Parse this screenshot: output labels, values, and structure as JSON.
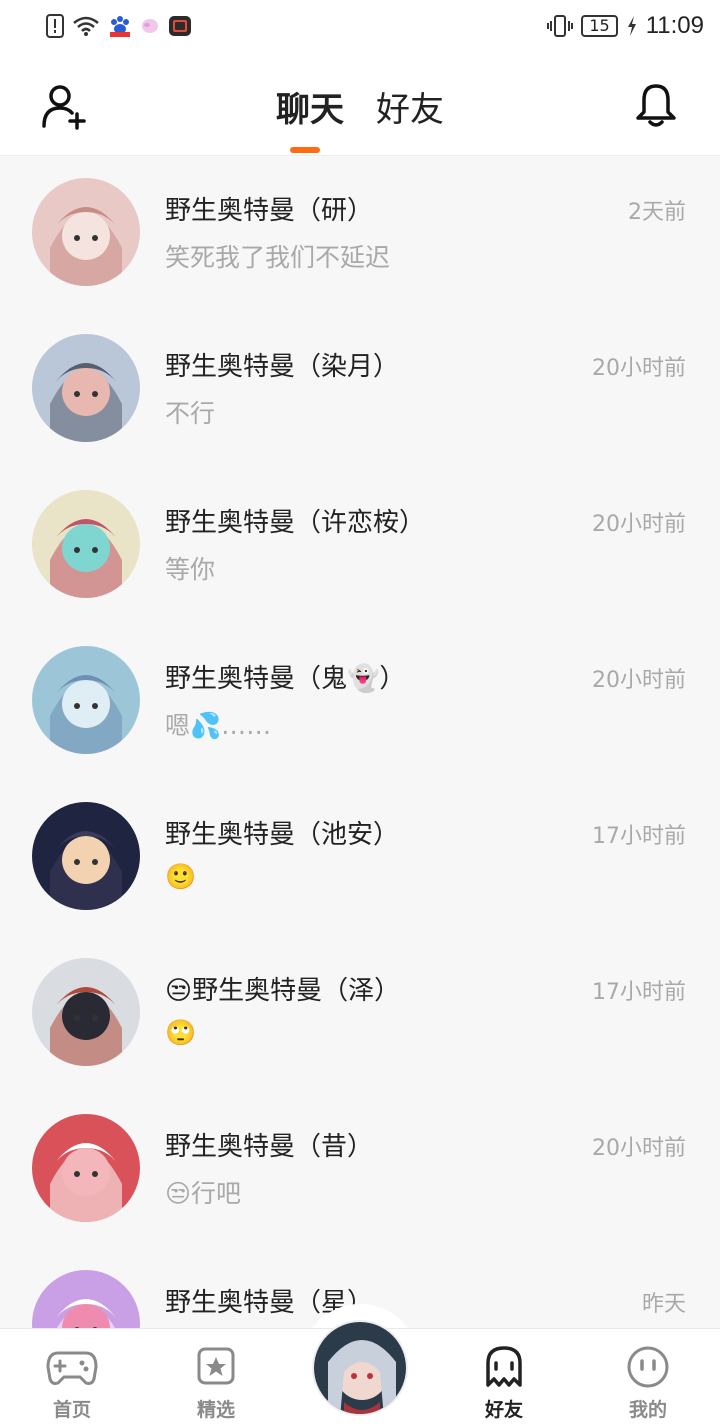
{
  "status_bar": {
    "time": "11:09",
    "battery": "15",
    "icons": [
      "alert-icon",
      "wifi-icon",
      "baidu-icon",
      "balloon-icon",
      "tv-icon",
      "vibrate-icon",
      "charging-icon"
    ]
  },
  "header": {
    "tabs": [
      {
        "label": "聊天",
        "active": true
      },
      {
        "label": "好友",
        "active": false
      }
    ],
    "left_icon": "add-friend-icon",
    "right_icon": "bell-icon"
  },
  "chats": [
    {
      "name": "野生奥特曼（研）",
      "message": "笑死我了我们不延迟",
      "time": "2天前",
      "avatar": {
        "bg": "#e8c9c6",
        "fg": "#f4e3df",
        "accent": "#c98b86"
      }
    },
    {
      "name": "野生奥特曼（染月）",
      "message": "不行",
      "time": "20小时前",
      "avatar": {
        "bg": "#b9c7d8",
        "fg": "#e8b8b0",
        "accent": "#5a5f70"
      }
    },
    {
      "name": "野生奥特曼（许恋桉）",
      "message": "等你",
      "time": "20小时前",
      "avatar": {
        "bg": "#e9e3c8",
        "fg": "#7fd6d0",
        "accent": "#c0556a"
      }
    },
    {
      "name": "野生奥特曼（鬼👻）",
      "message": "嗯💦……",
      "time": "20小时前",
      "avatar": {
        "bg": "#9cc6d8",
        "fg": "#dfeef4",
        "accent": "#6d8fb5"
      }
    },
    {
      "name": "野生奥特曼（池安）",
      "message": "🙂",
      "time": "17小时前",
      "avatar": {
        "bg": "#1f2440",
        "fg": "#f2d2b0",
        "accent": "#3a3a5a"
      }
    },
    {
      "name": "😒野生奥特曼（泽）",
      "message": "🙄",
      "time": "17小时前",
      "avatar": {
        "bg": "#d9dde2",
        "fg": "#2a2a35",
        "accent": "#b04a3a"
      }
    },
    {
      "name": "野生奥特曼（昔）",
      "message": "😒行吧",
      "time": "20小时前",
      "avatar": {
        "bg": "#d9525a",
        "fg": "#f3b6bb",
        "accent": "#ffffff"
      }
    },
    {
      "name": "野生奥特曼（星）",
      "message": "",
      "time": "昨天",
      "avatar": {
        "bg": "#c9a0e6",
        "fg": "#f08bb0",
        "accent": "#ffffff"
      }
    }
  ],
  "bottom_nav": {
    "items": [
      {
        "label": "首页",
        "icon": "gamepad-icon",
        "active": false
      },
      {
        "label": "精选",
        "icon": "star-icon",
        "active": false
      },
      {
        "label": "",
        "icon": "center-avatar",
        "active": false
      },
      {
        "label": "好友",
        "icon": "ghost-icon",
        "active": true
      },
      {
        "label": "我的",
        "icon": "face-icon",
        "active": false
      }
    ]
  },
  "colors": {
    "accent": "#ff6a13",
    "text_primary": "#222222",
    "text_secondary": "#a9a9a9",
    "background": "#f7f7f7"
  }
}
